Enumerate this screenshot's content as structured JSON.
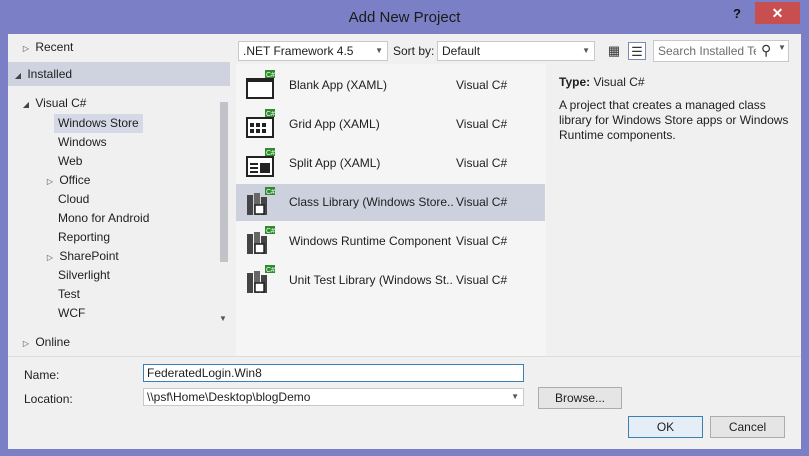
{
  "window": {
    "title": "Add New Project",
    "help_label": "?",
    "close_label": "✕"
  },
  "tree": {
    "recent": "Recent",
    "installed": "Installed",
    "language": "Visual C#",
    "children": [
      "Windows Store",
      "Windows",
      "Web",
      "Office",
      "Cloud",
      "Mono for Android",
      "Reporting",
      "SharePoint",
      "Silverlight",
      "Test",
      "WCF"
    ],
    "online": "Online"
  },
  "toolbar": {
    "framework": ".NET Framework 4.5",
    "sort_label": "Sort by:",
    "sort_value": "Default",
    "search_placeholder": "Search Installed Te"
  },
  "templates": [
    {
      "name": "Blank App (XAML)",
      "lang": "Visual C#",
      "icon": "blank-app-icon"
    },
    {
      "name": "Grid App (XAML)",
      "lang": "Visual C#",
      "icon": "grid-app-icon"
    },
    {
      "name": "Split App (XAML)",
      "lang": "Visual C#",
      "icon": "split-app-icon"
    },
    {
      "name": "Class Library (Windows Store...",
      "lang": "Visual C#",
      "icon": "class-library-icon"
    },
    {
      "name": "Windows Runtime Component",
      "lang": "Visual C#",
      "icon": "runtime-component-icon"
    },
    {
      "name": "Unit Test Library (Windows St...",
      "lang": "Visual C#",
      "icon": "unit-test-icon"
    }
  ],
  "details": {
    "type_label": "Type:",
    "type_value": "Visual C#",
    "description": "A project that creates a managed class library for Windows Store apps or Windows Runtime components."
  },
  "form": {
    "name_label": "Name:",
    "name_value": "FederatedLogin.Win8",
    "location_label": "Location:",
    "location_value": "\\\\psf\\Home\\Desktop\\blogDemo",
    "browse_label": "Browse...",
    "ok_label": "OK",
    "cancel_label": "Cancel"
  },
  "colors": {
    "title_bar": "#7b80c6",
    "close_button": "#c74f4f",
    "selection": "#cdd1de",
    "csharp_badge": "#2e8b2e"
  }
}
